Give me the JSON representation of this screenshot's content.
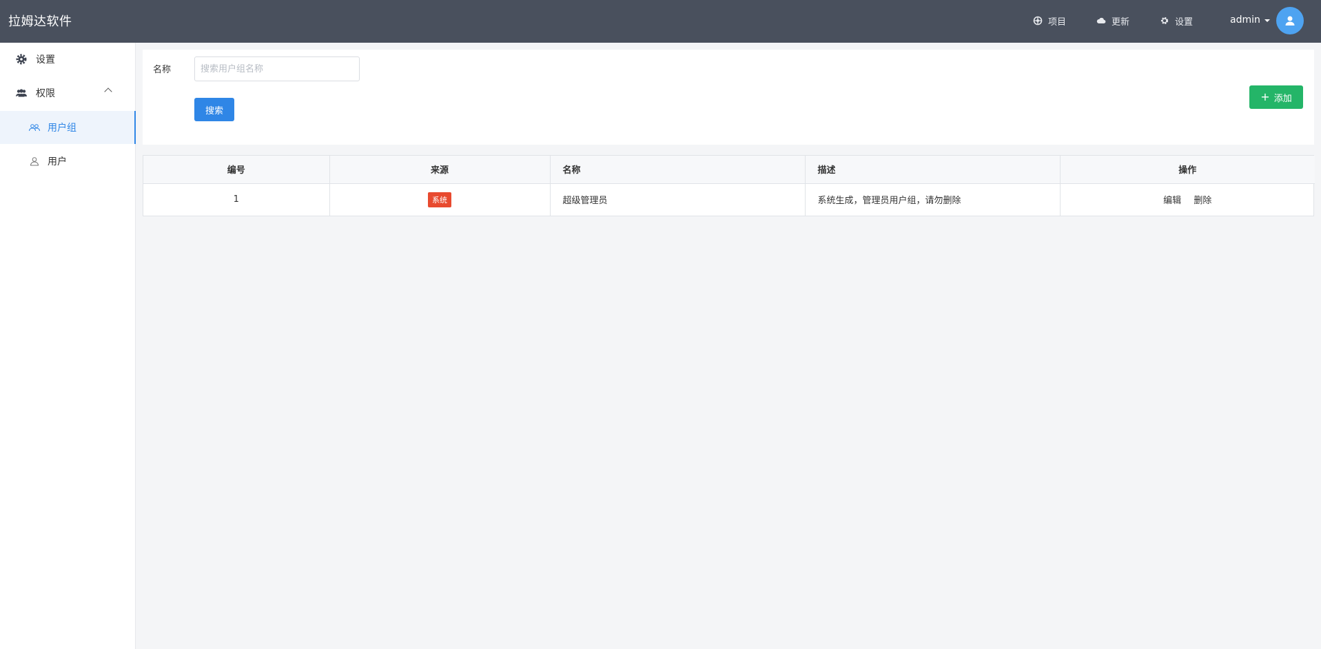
{
  "app": {
    "title": "拉姆达软件"
  },
  "header": {
    "nav": [
      {
        "label": "项目",
        "icon": "project-icon"
      },
      {
        "label": "更新",
        "icon": "cloud-icon"
      },
      {
        "label": "设置",
        "icon": "gear-icon"
      }
    ],
    "user": {
      "name": "admin",
      "icon": "user-avatar-icon"
    }
  },
  "sidebar": {
    "items": [
      {
        "label": "设置",
        "icon": "gear-icon"
      },
      {
        "label": "权限",
        "icon": "users-icon",
        "expanded": true
      },
      {
        "label": "用户组",
        "icon": "user-group-icon",
        "active": true
      },
      {
        "label": "用户",
        "icon": "user-icon"
      }
    ]
  },
  "search": {
    "name_label": "名称",
    "placeholder": "搜索用户组名称",
    "value": "",
    "search_button": "搜索",
    "add_button": "添加"
  },
  "table": {
    "columns": [
      "编号",
      "来源",
      "名称",
      "描述",
      "操作"
    ],
    "rows": [
      {
        "id": "1",
        "source": "系统",
        "name": "超级管理员",
        "description": "系统生成，管理员用户组，请勿删除",
        "actions": [
          "编辑",
          "删除"
        ]
      }
    ]
  },
  "colors": {
    "header_bg": "#49505d",
    "primary": "#2f86e6",
    "success": "#24b568",
    "badge_red": "#e84a2f"
  }
}
